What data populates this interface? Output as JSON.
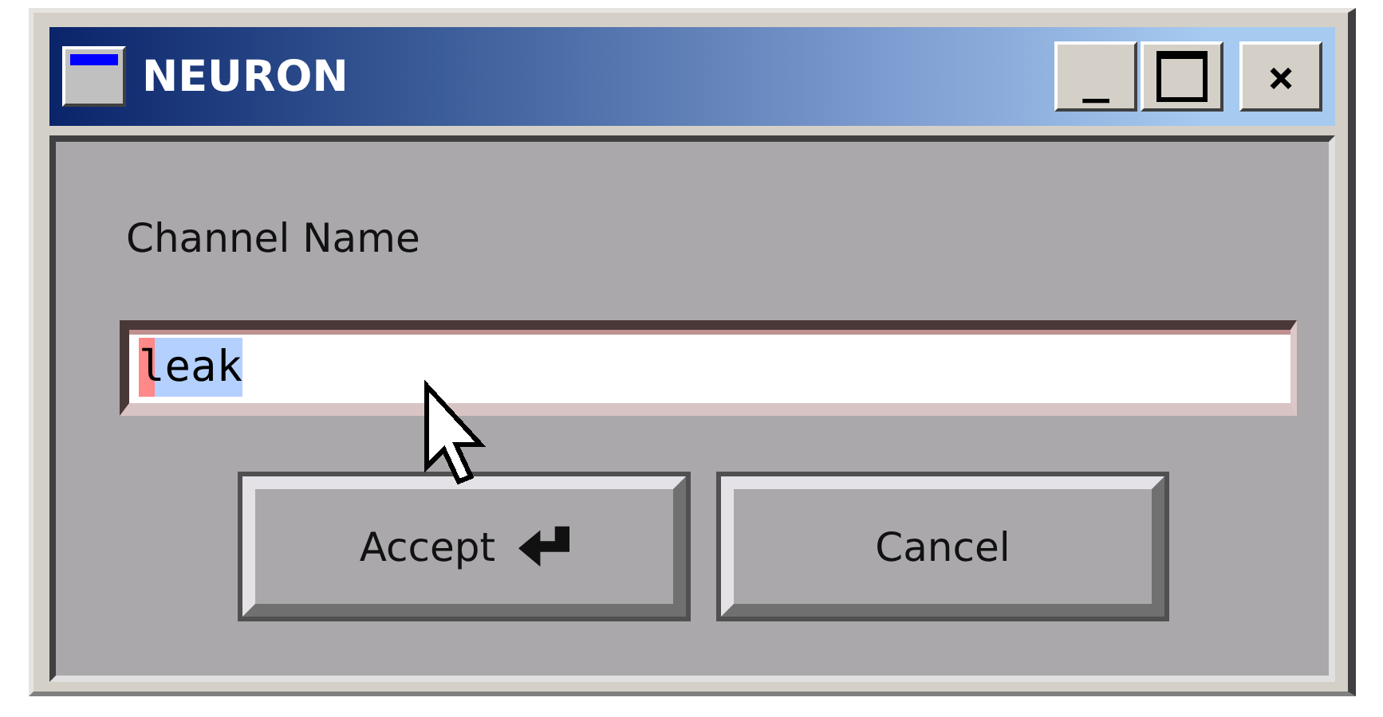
{
  "window": {
    "title": "NEURON",
    "controls": [
      "_",
      "×"
    ]
  },
  "label": "Channel Name",
  "field": {
    "value": "leak",
    "selected": true
  },
  "buttons": [
    {
      "label": "Accept",
      "kind": "default"
    },
    {
      "label": "Cancel",
      "kind": "normal"
    }
  ]
}
